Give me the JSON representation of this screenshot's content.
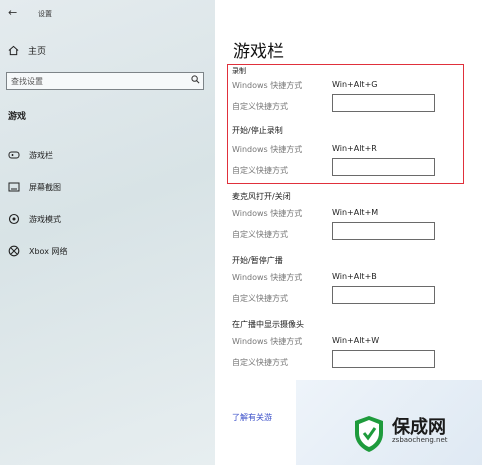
{
  "window": {
    "title": "设置",
    "back_icon": "back-arrow-icon"
  },
  "sidebar": {
    "home_label": "主页",
    "search_placeholder": "查找设置",
    "section_title": "游戏",
    "items": [
      {
        "label": "游戏栏",
        "icon": "gamebar-icon"
      },
      {
        "label": "屏幕截图",
        "icon": "screenshot-icon"
      },
      {
        "label": "游戏模式",
        "icon": "gamemode-icon"
      },
      {
        "label": "Xbox 网络",
        "icon": "xbox-icon"
      }
    ]
  },
  "main": {
    "title": "游戏栏",
    "groups": [
      {
        "heading": "录制",
        "windows_label": "Windows 快捷方式",
        "windows_value": "Win+Alt+G",
        "custom_label": "自定义快捷方式",
        "custom_value": ""
      },
      {
        "heading": "开始/停止录制",
        "windows_label": "Windows 快捷方式",
        "windows_value": "Win+Alt+R",
        "custom_label": "自定义快捷方式",
        "custom_value": ""
      },
      {
        "heading": "麦克风打开/关闭",
        "windows_label": "Windows 快捷方式",
        "windows_value": "Win+Alt+M",
        "custom_label": "自定义快捷方式",
        "custom_value": ""
      },
      {
        "heading": "开始/暂停广播",
        "windows_label": "Windows 快捷方式",
        "windows_value": "Win+Alt+B",
        "custom_label": "自定义快捷方式",
        "custom_value": ""
      },
      {
        "heading": "在广播中显示摄像头",
        "windows_label": "Windows 快捷方式",
        "windows_value": "Win+Alt+W",
        "custom_label": "自定义快捷方式",
        "custom_value": ""
      }
    ],
    "learn_more": "了解有关游"
  },
  "highlight_color": "#e0303b",
  "watermark": {
    "brand": "保成网",
    "url": "zsbaocheng.net"
  }
}
